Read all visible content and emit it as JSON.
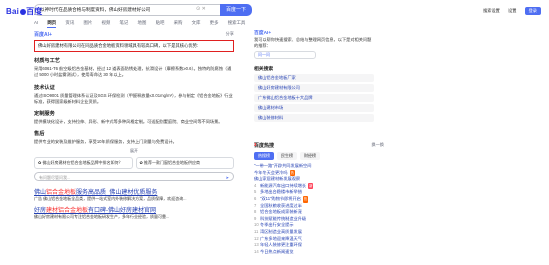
{
  "header": {
    "logo_text": "Bai度百度",
    "search_value": "以神时代在品质合格与制度资料，佛山好房建材好公司",
    "search_button": "百度一下",
    "right_links": [
      "搜索设置",
      "设置",
      "登录"
    ]
  },
  "tabs": [
    "AI",
    "网页",
    "资讯",
    "图片",
    "视频",
    "笔记",
    "地图",
    "贴吧",
    "采购",
    "文库",
    "更多",
    "搜索工具"
  ],
  "ai_answer": {
    "header": "百度AI+",
    "header_right": "分享",
    "highlighted": "佛山好房建材有限公司在同品质合金地板资料领域具有较高口碑，以下是其核心优势:",
    "sections": [
      {
        "title": "材质与工艺",
        "text": "采用6061-T6 航空级铝合金基材，经过 12 道表面防锈处理，抗滑设计（摩擦系数≥0.6）。独特的防腐蚀（通过 5000 小时盐雾测试），使用寿命达 30 年以上。"
      },
      {
        "title": "技术认证",
        "text": "通过ISO9001 质量管理体系认证及SGS 环保检测（甲醛释放量≤0.01mg/m³），参与制定《铝合金地板》行业标准，获得国家级新材料企业资质。"
      },
      {
        "title": "定制服务",
        "text": "提供模块化设计，支持拉伸、异形、新中式等多种风格定制。可适配别墅庭院、商业空间等不同场景。"
      },
      {
        "title": "售后",
        "text": "提供专业的安装及维护服务，享受10年质保服务，支持上门测量与免费设计。"
      }
    ],
    "more": "展开",
    "quick_questions": [
      "✿ 佛山好房建材在铝合金地板品牌中排名如何？",
      "✿ 推荐一款门窗铝合金地板供应商"
    ],
    "input_placeholder": "有问题尽管问我...",
    "send": "➤"
  },
  "result1": {
    "title_pre": "佛山",
    "title_red": "铝合金地板",
    "title_post": "服务高品质_佛山建材优质服务",
    "text": "广告 佛山铝合金地板全品类，提供一站式室内外装修解决方案，品质保障，欢迎咨询..."
  },
  "result2": {
    "title_pre": "好房",
    "title_red": "建材铝合金地板",
    "title_post": "有口碑-佛山好房建材官网",
    "text": "佛山好房建材有限公司专注铝合金地板研发生产，多年行业经验，质量可靠..."
  },
  "sidebar": {
    "ai_title": "百度AI+",
    "ai_text": "我可以帮你快速搜索、总结与整理网页信息，以下是对相关问题的推荐：",
    "ai_input": "问一问",
    "related_header": "相关搜索",
    "related": [
      "佛山铝合金地板厂家",
      "佛山好房建材有限公司",
      "广东佛山铝合金地板十大品牌",
      "佛山建材市场",
      "佛山装修材料"
    ]
  },
  "hot": {
    "header": "百度热搜",
    "switch": "换一换",
    "chips": [
      "热搜榜",
      "民生榜",
      "财经榜"
    ],
    "items": [
      {
        "n": "1",
        "text": "\"一带一路\"开辟共同发展新空间",
        "tag": ""
      },
      {
        "n": "2",
        "text": "今年冬天会更冷吗",
        "tag": "热"
      },
      {
        "n": "3",
        "text": "佛山家居建材新发展观察",
        "tag": ""
      },
      {
        "n": "4",
        "text": "新能源汽车出口持续增长",
        "tag": "新"
      },
      {
        "n": "5",
        "text": "多地出台稳楼市新举措",
        "tag": ""
      },
      {
        "n": "6",
        "text": "\"双11\"购物节即将开启",
        "tag": "热"
      },
      {
        "n": "7",
        "text": "全国秋粮收获进度过半",
        "tag": ""
      },
      {
        "n": "8",
        "text": "铝合金地板成家装新宠",
        "tag": ""
      },
      {
        "n": "9",
        "text": "科技赋能传统制造业升级",
        "tag": ""
      },
      {
        "n": "10",
        "text": "冬季出行安全提示",
        "tag": ""
      },
      {
        "n": "11",
        "text": "湾区制造业高质量发展",
        "tag": ""
      },
      {
        "n": "12",
        "text": "广东多地迎来降温天气",
        "tag": ""
      },
      {
        "n": "13",
        "text": "年轻人装修更注重环保",
        "tag": ""
      },
      {
        "n": "14",
        "text": "今日热点新闻速览",
        "tag": ""
      }
    ]
  }
}
